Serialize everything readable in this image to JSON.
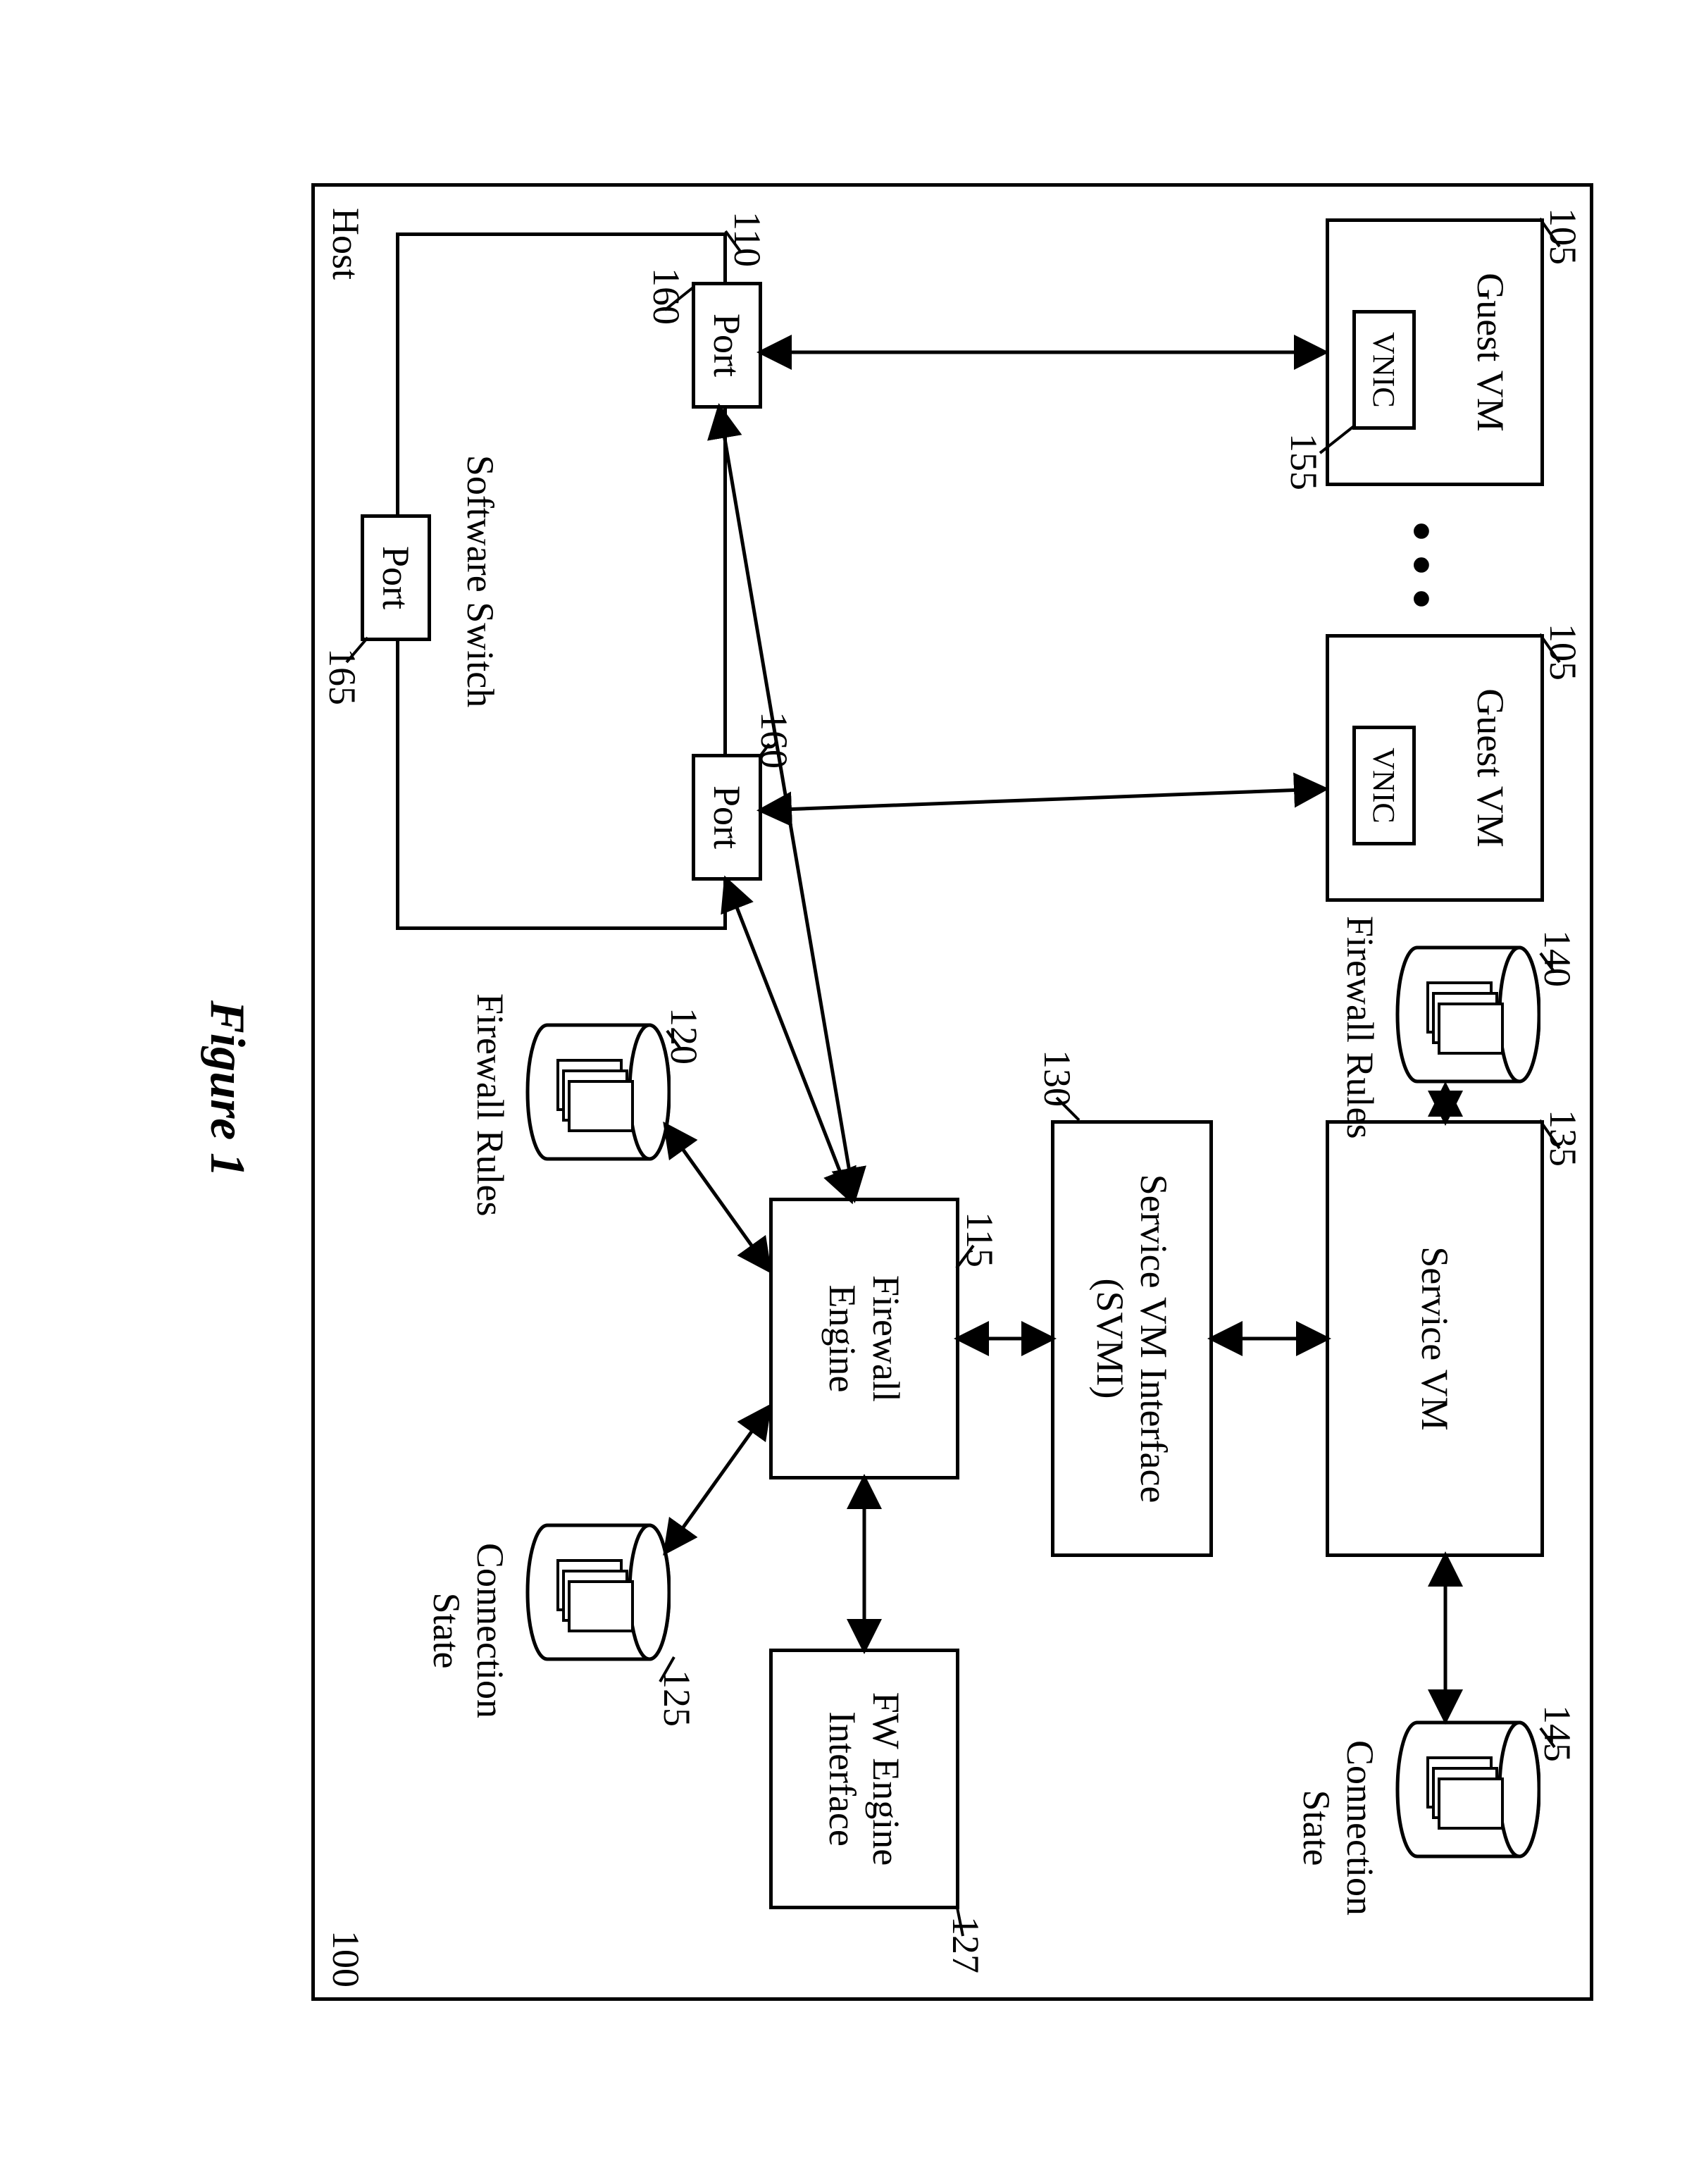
{
  "figure_label": "Figure 1",
  "refs": {
    "host": "100",
    "guest_vm_a": "105",
    "guest_vm_b": "105",
    "switch": "110",
    "fw_engine": "115",
    "fw_rules_engine": "120",
    "conn_state_engine": "125",
    "fw_eng_if": "127",
    "svmi": "130",
    "service_vm": "135",
    "fw_rules_svm": "140",
    "conn_state_svm": "145",
    "vnic": "155",
    "port_left": "160",
    "port_right": "160",
    "port_bottom": "165"
  },
  "labels": {
    "host": "Host",
    "guest_vm": "Guest VM",
    "vnic": "VNIC",
    "service_vm": "Service VM",
    "svmi_l1": "Service VM Interface",
    "svmi_l2": "(SVMI)",
    "fw_engine_l1": "Firewall",
    "fw_engine_l2": "Engine",
    "fw_eng_if_l1": "FW Engine",
    "fw_eng_if_l2": "Interface",
    "fw_rules": "Firewall Rules",
    "conn_state_l1": "Connection",
    "conn_state_l2": "State",
    "switch": "Software Switch",
    "port": "Port"
  }
}
